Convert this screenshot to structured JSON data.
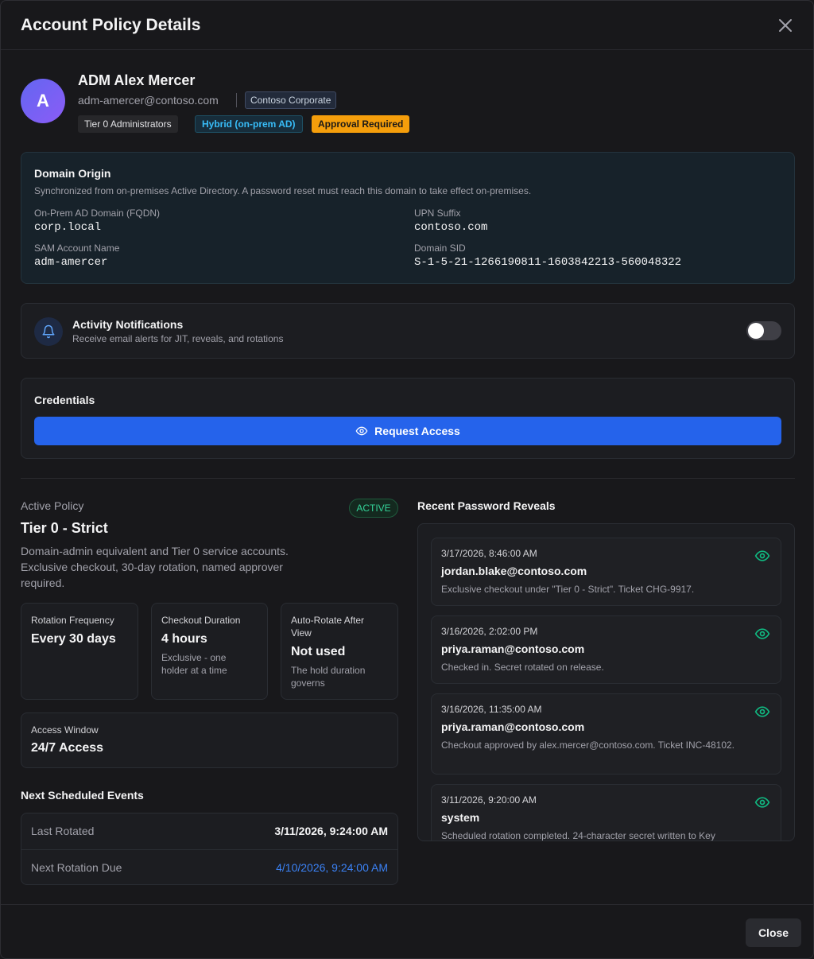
{
  "modal": {
    "title": "Account Policy Details"
  },
  "profile": {
    "avatar_letter": "A",
    "name": "ADM Alex Mercer",
    "email": "adm-amercer@contoso.com",
    "org": "Contoso Corporate",
    "badges": {
      "group": "Tier 0 Administrators",
      "source": "Hybrid (on-prem AD)",
      "approval": "Approval Required"
    }
  },
  "domain_origin": {
    "title": "Domain Origin",
    "description": "Synchronized from on-premises Active Directory. A password reset must reach this domain to take effect on-premises.",
    "fields": [
      {
        "label": "On-Prem AD Domain (FQDN)",
        "value": "corp.local"
      },
      {
        "label": "UPN Suffix",
        "value": "contoso.com"
      },
      {
        "label": "SAM Account Name",
        "value": "adm-amercer"
      },
      {
        "label": "Domain SID",
        "value": "S-1-5-21-1266190811-1603842213-560048322"
      }
    ]
  },
  "notifications": {
    "title": "Activity Notifications",
    "description": "Receive email alerts for JIT, reveals, and rotations",
    "enabled": false
  },
  "credentials": {
    "title": "Credentials",
    "button_label": "Request Access"
  },
  "policy": {
    "label": "Active Policy",
    "status": "ACTIVE",
    "name": "Tier 0 - Strict",
    "description": "Domain-admin equivalent and Tier 0 service accounts. Exclusive checkout, 30-day rotation, named approver required.",
    "stats": [
      {
        "label": "Rotation Frequency",
        "value": "Every 30 days",
        "sub": ""
      },
      {
        "label": "Checkout Duration",
        "value": "4 hours",
        "sub": "Exclusive - one holder at a time"
      },
      {
        "label": "Auto-Rotate After View",
        "value": "Not used",
        "sub": "The hold duration governs"
      }
    ],
    "access_window": {
      "label": "Access Window",
      "value": "24/7 Access"
    }
  },
  "schedule": {
    "title": "Next Scheduled Events",
    "rows": [
      {
        "label": "Last Rotated",
        "value": "3/11/2026, 9:24:00 AM"
      },
      {
        "label": "Next Rotation Due",
        "value": "4/10/2026, 9:24:00 AM"
      }
    ]
  },
  "reveals": {
    "title": "Recent Password Reveals",
    "items": [
      {
        "timestamp": "3/17/2026, 8:46:00 AM",
        "user": "jordan.blake@contoso.com",
        "note": "Exclusive checkout under \"Tier 0 - Strict\". Ticket CHG-9917."
      },
      {
        "timestamp": "3/16/2026, 2:02:00 PM",
        "user": "priya.raman@contoso.com",
        "note": "Checked in. Secret rotated on release."
      },
      {
        "timestamp": "3/16/2026, 11:35:00 AM",
        "user": "priya.raman@contoso.com",
        "note": "Checkout approved by alex.mercer@contoso.com. Ticket INC-48102."
      },
      {
        "timestamp": "3/11/2026, 9:20:00 AM",
        "user": "system",
        "note": "Scheduled rotation completed. 24-character secret written to Key"
      }
    ]
  },
  "footer": {
    "close_label": "Close"
  },
  "colors": {
    "accent": "#2563eb",
    "active_green": "#34d399",
    "warning": "#f59e0b",
    "info": "#38bdf8"
  }
}
